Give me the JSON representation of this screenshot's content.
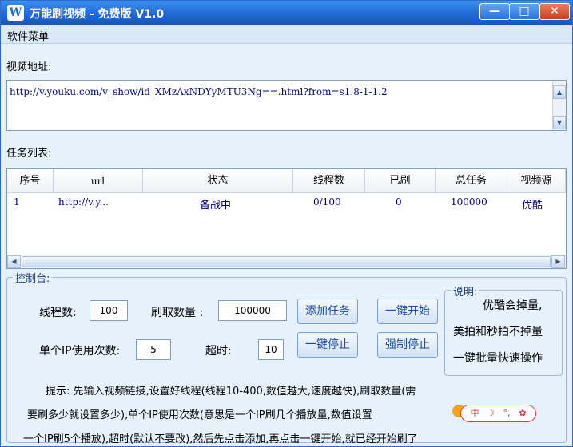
{
  "window": {
    "title": "万能刷视频 - 免费版 V1.0",
    "app_icon_glyph": "W",
    "minimize_glyph": "—",
    "maximize_glyph": "□",
    "close_glyph": "✕"
  },
  "menu": {
    "items": [
      "软件菜单"
    ]
  },
  "video_address": {
    "label": "视频地址:",
    "value": "http://v.youku.com/v_show/id_XMzAxNDYyMTU3Ng==.html?from=s1.8-1-1.2"
  },
  "task_list": {
    "label": "任务列表:",
    "columns": [
      "序号",
      "url",
      "状态",
      "线程数",
      "已刷",
      "总任务",
      "视频源"
    ],
    "rows": [
      [
        "1",
        "http://v.y...",
        "备战中",
        "0/100",
        "0",
        "100000",
        "优酷"
      ]
    ]
  },
  "control_panel": {
    "title": "控制台:",
    "thread_count_label": "线程数:",
    "thread_count_value": "100",
    "brush_count_label": "刷取数量 :",
    "brush_count_value": "100000",
    "ip_uses_label": "单个IP使用次数:",
    "ip_uses_value": "5",
    "timeout_label": "超时:",
    "timeout_value": "10",
    "buttons": {
      "add_task": "添加任务",
      "start_all": "一键开始",
      "stop_all": "一键停止",
      "force_stop": "强制停止"
    }
  },
  "notes": {
    "title": "说明:",
    "lines": [
      "优酷会掉量,",
      "美拍和秒拍不掉量",
      "一键批量快速操作"
    ]
  },
  "hint": {
    "lines": [
      "提示: 先输入视频链接,设置好线程(线程10-400,数值越大,速度越快),刷取数量(需",
      "要刷多少就设置多少),单个IP使用次数(意思是一个IP刷几个播放量,数值设置",
      "一个IP刷5个播放),超时(默认不要改),然后先点击添加,再点击一键开始,就已经开始刷了"
    ]
  },
  "overlay_toolbar": {
    "icons": [
      "input-method-icon",
      "moon-icon",
      "punctuation-icon",
      "settings-gear-icon"
    ],
    "glyphs": [
      "中",
      "☽",
      "°,",
      "✿"
    ]
  },
  "colors": {
    "titlebar": "#1f66d6",
    "window_bg": "#e7f1fb",
    "table_text": "#000080",
    "button_text": "#1b4aa8",
    "overlay_accent": "#d83d3d"
  }
}
